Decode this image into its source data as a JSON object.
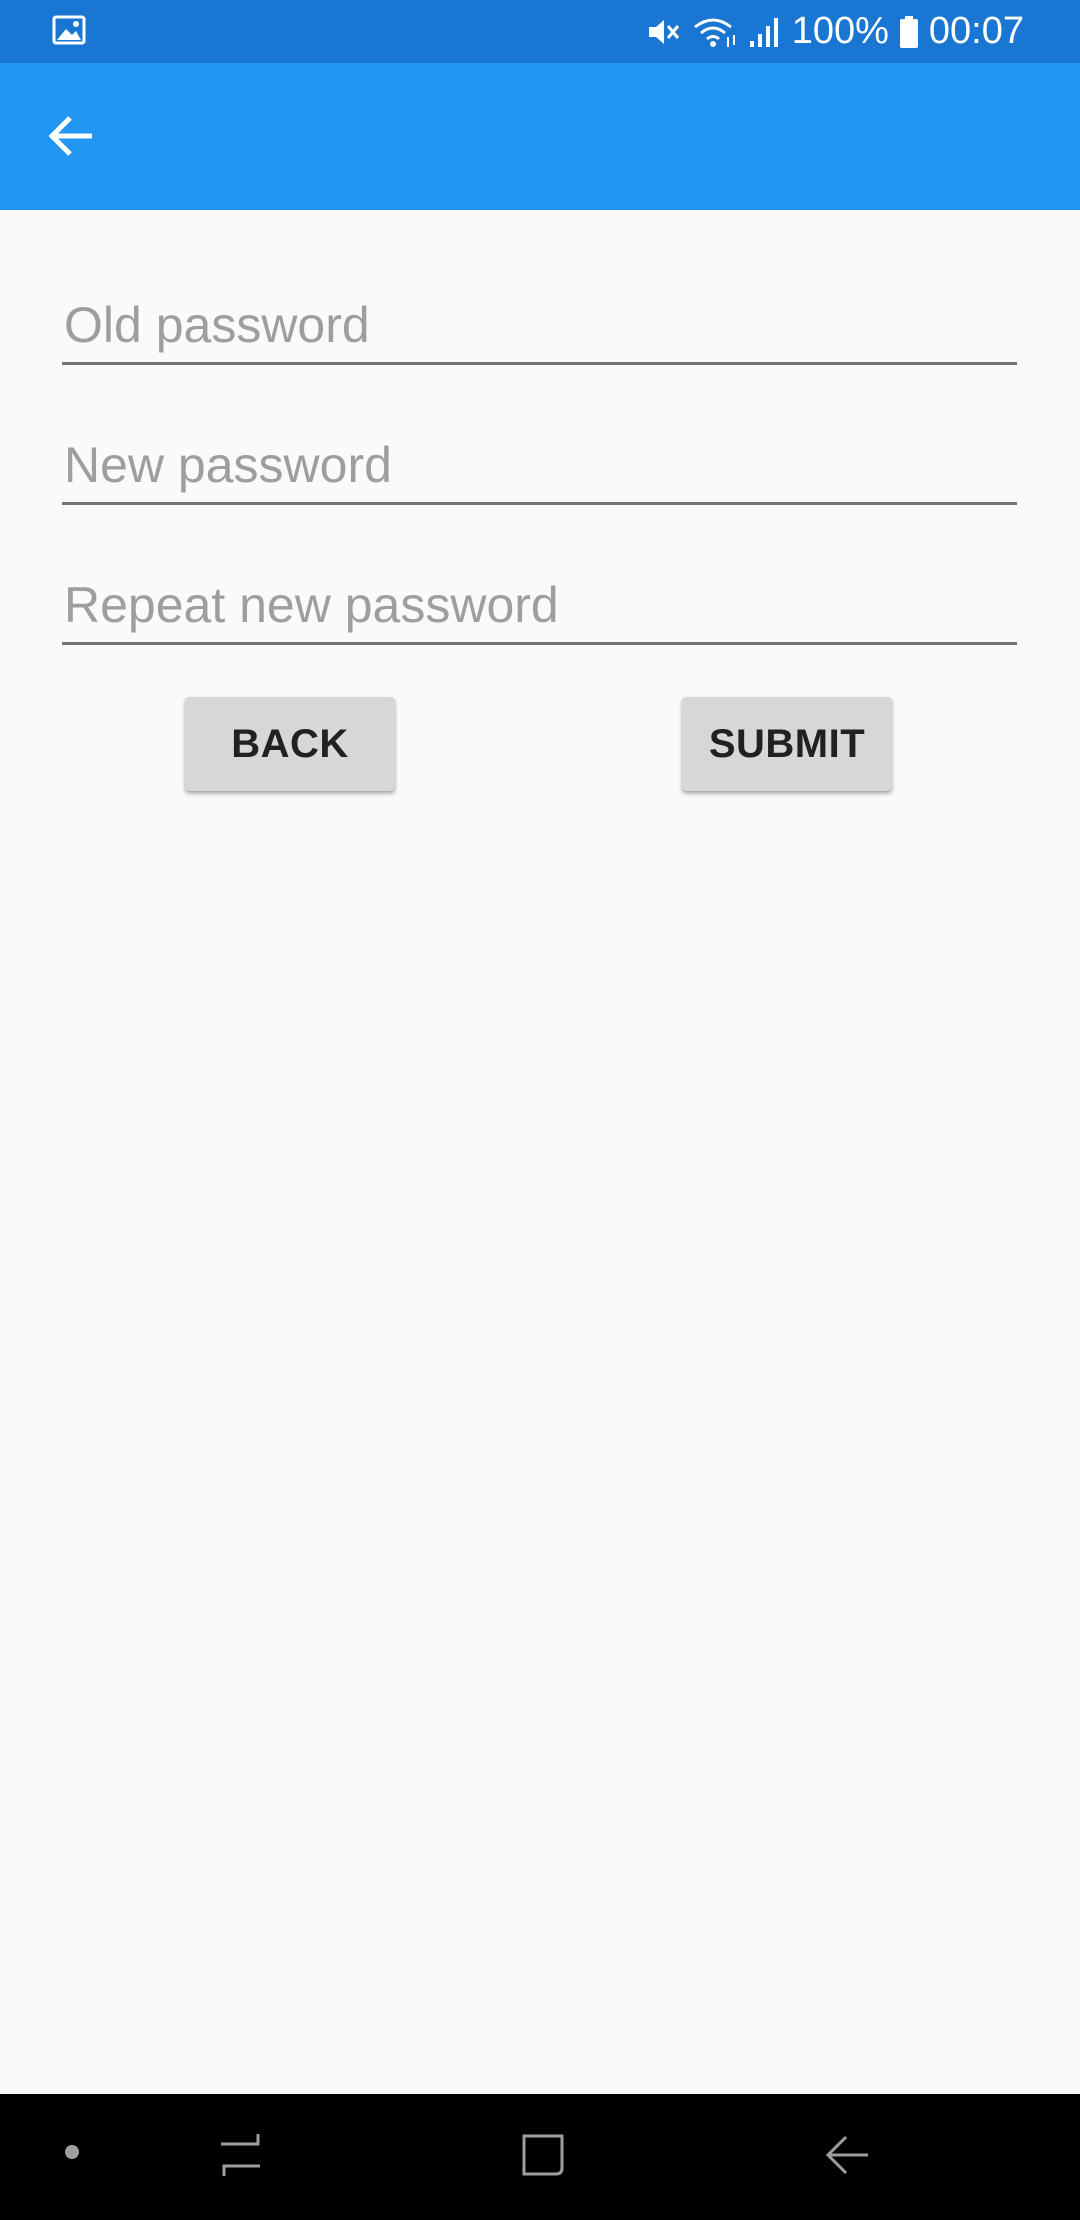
{
  "status_bar": {
    "battery_text": "100%",
    "time": "00:07",
    "icons": [
      "gallery-icon",
      "mute-icon",
      "wifi-icon",
      "signal-icon",
      "battery-icon"
    ]
  },
  "app_bar": {
    "back_icon": "arrow-back-icon",
    "color": "#2196F3"
  },
  "form": {
    "old_password_placeholder": "Old password",
    "new_password_placeholder": "New password",
    "repeat_password_placeholder": "Repeat new password",
    "back_label": "BACK",
    "submit_label": "SUBMIT"
  },
  "nav_bar": {
    "icons": [
      "dot-icon",
      "recents-icon",
      "home-icon",
      "back-icon"
    ]
  },
  "colors": {
    "status_bar": "#1976D2",
    "app_bar": "#2196F3",
    "background": "#FAFAFA",
    "button": "#D6D7D7"
  }
}
